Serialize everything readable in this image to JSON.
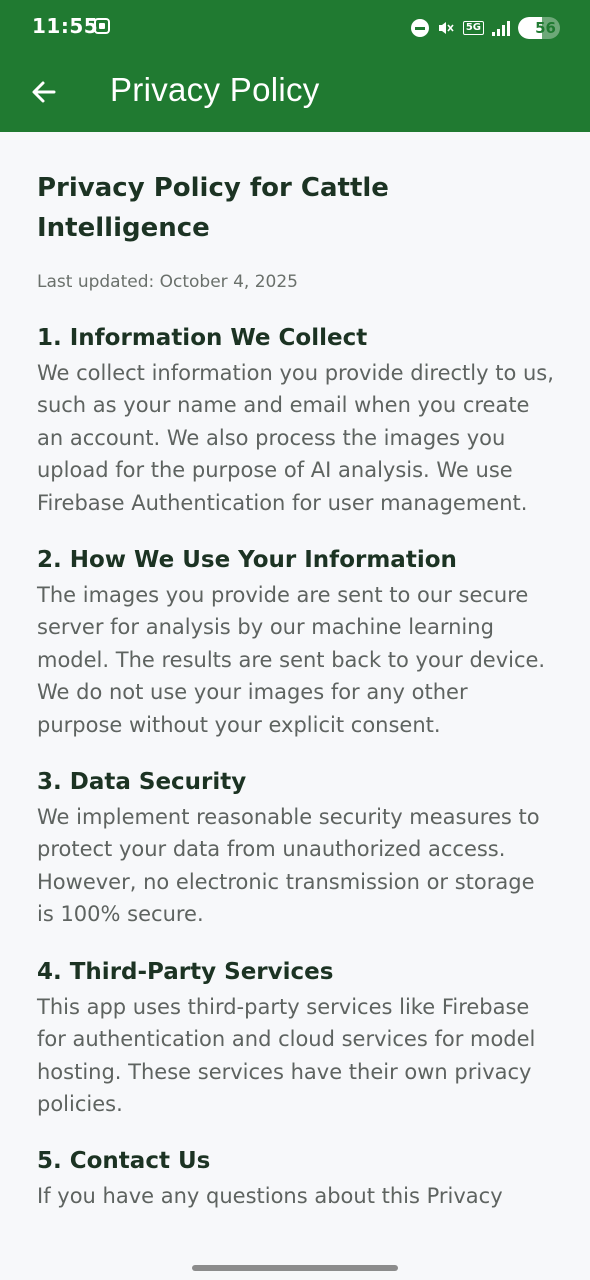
{
  "status_bar": {
    "time": "11:55",
    "network_label": "5G",
    "battery_level": "56",
    "battery_fraction": 0.56,
    "icons": [
      "screenshot-icon",
      "do-not-disturb-icon",
      "mute-icon",
      "network-5g-icon",
      "signal-icon",
      "battery-icon"
    ]
  },
  "app_bar": {
    "title": "Privacy Policy",
    "back_icon": "arrow-left-icon",
    "color": "#207a31"
  },
  "policy": {
    "title": "Privacy Policy for Cattle Intelligence",
    "last_updated": "Last updated: October 4, 2025",
    "sections": [
      {
        "heading": "1. Information We Collect",
        "body": "We collect information you provide directly to us, such as your name and email when you create an account. We also process the images you upload for the purpose of AI analysis. We use Firebase Authentication for user management."
      },
      {
        "heading": "2. How We Use Your Information",
        "body": "The images you provide are sent to our secure server for analysis by our machine learning model. The results are sent back to your device. We do not use your images for any other purpose without your explicit consent."
      },
      {
        "heading": "3. Data Security",
        "body": "We implement reasonable security measures to protect your data from unauthorized access. However, no electronic transmission or storage is 100% secure."
      },
      {
        "heading": "4. Third-Party Services",
        "body": "This app uses third-party services like Firebase for authentication and cloud services for model hosting. These services have their own privacy policies."
      },
      {
        "heading": "5. Contact Us",
        "body": "If you have any questions about this Privacy"
      }
    ]
  }
}
